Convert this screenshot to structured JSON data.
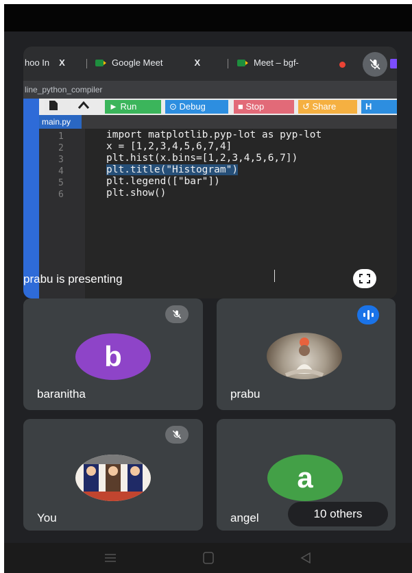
{
  "browser": {
    "tabs": [
      {
        "label": "hoo In",
        "close": "X"
      },
      {
        "label": "Google Meet",
        "close": "X"
      },
      {
        "label": "Meet – bgf-"
      }
    ],
    "url": "line_python_compiler"
  },
  "ide": {
    "toolbar": {
      "run": "Run",
      "debug": "Debug",
      "stop": "Stop",
      "share": "Share"
    },
    "file_tab": "main.py",
    "line_numbers": [
      "1",
      "2",
      "3",
      "4",
      "5",
      "6"
    ],
    "code_lines": [
      "import matplotlib.pyp-lot as pyp-lot",
      "x = [1,2,3,4,5,6,7,4]",
      "plt.hist(x.bins=[1,2,3,4,5,6,7])",
      "plt.title(\"Histogram\")",
      "plt.legend([\"bar\"])",
      "plt.show()"
    ]
  },
  "presentation": {
    "caption": "prabu is presenting"
  },
  "participants": [
    {
      "name": "baranitha",
      "initial": "b",
      "avatar_color": "#8e44c8",
      "muted": true
    },
    {
      "name": "prabu",
      "speaking": true
    },
    {
      "name": "You",
      "muted": true
    },
    {
      "name": "angel",
      "initial": "a",
      "avatar_color": "#43a047"
    }
  ],
  "others": {
    "label": "10 others"
  },
  "icons": [
    "mic-off-icon",
    "fullscreen-icon",
    "speaking-icon",
    "menu-icon",
    "home-icon",
    "back-icon"
  ]
}
